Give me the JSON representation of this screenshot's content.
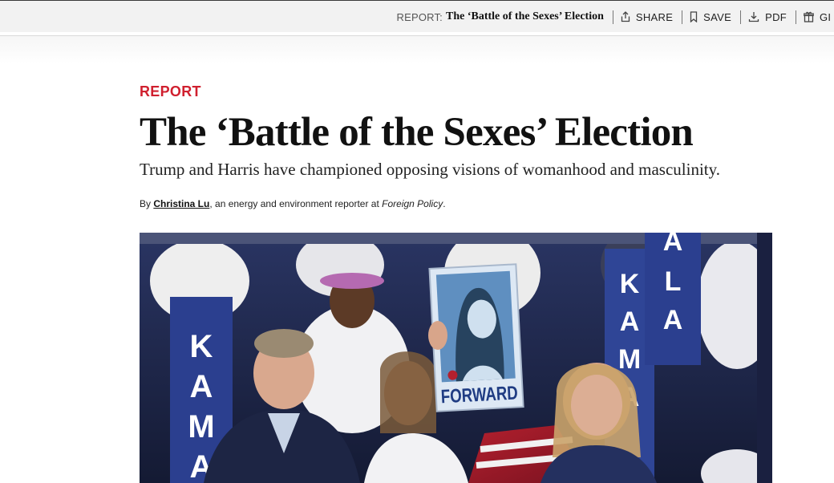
{
  "topbar": {
    "kicker": "REPORT:",
    "article_title": "The ‘Battle of the Sexes’ Election",
    "share_label": "SHARE",
    "save_label": "SAVE",
    "pdf_label": "PDF",
    "gift_label": "GI"
  },
  "article": {
    "kicker": "REPORT",
    "headline": "The ‘Battle of the Sexes’ Election",
    "dek": "Trump and Harris have championed opposing visions of womanhood and masculinity.",
    "byline": {
      "prefix": "By ",
      "author": "Christina Lu",
      "middle": ", an energy and environment reporter at ",
      "publication": "Foreign Policy",
      "suffix": "."
    }
  },
  "hero": {
    "sign_letters_left": [
      "K",
      "A",
      "M",
      "A"
    ],
    "sign_letters_right": [
      "A",
      "L",
      "A"
    ],
    "sign_letters_mid": [
      "K",
      "A",
      "M",
      "A"
    ],
    "poster_caption": "FORWARD",
    "colors": {
      "sign_blue": "#2b3f8f",
      "poster_frame": "#dde8f4",
      "poster_portrait": "#27435f",
      "crowd_bg": "#1c2348"
    }
  }
}
